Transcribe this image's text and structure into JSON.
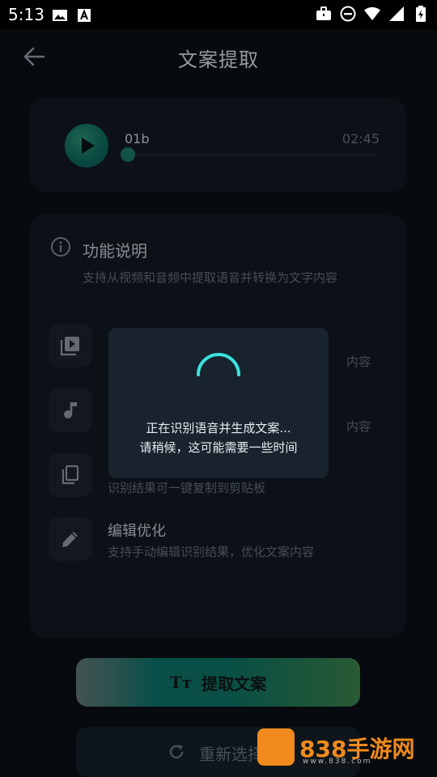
{
  "status_bar": {
    "time": "5:13"
  },
  "header": {
    "title": "文案提取"
  },
  "audio": {
    "name": "01b",
    "duration": "02:45",
    "progress": 0
  },
  "info": {
    "title": "功能说明",
    "description": "支持从视频和音频中提取语音并转换为文字内容",
    "features": [
      {
        "title": "",
        "desc": "内容"
      },
      {
        "title": "",
        "desc": "内容"
      },
      {
        "title": "",
        "desc": "识别结果可一键复制到剪贴板"
      },
      {
        "title": "编辑优化",
        "desc": "支持手动编辑识别结果，优化文案内容"
      }
    ]
  },
  "buttons": {
    "extract": "提取文案",
    "reselect": "重新选择"
  },
  "loading": {
    "line1": "正在识别语音并生成文案...",
    "line2": "请稍候，这可能需要一些时间"
  },
  "watermark": {
    "text": "838手游网",
    "sub": "www.838.com"
  },
  "colors": {
    "accent": "#1d7f70",
    "spinner": "#3be3e0",
    "watermark": "#f08a1c"
  }
}
